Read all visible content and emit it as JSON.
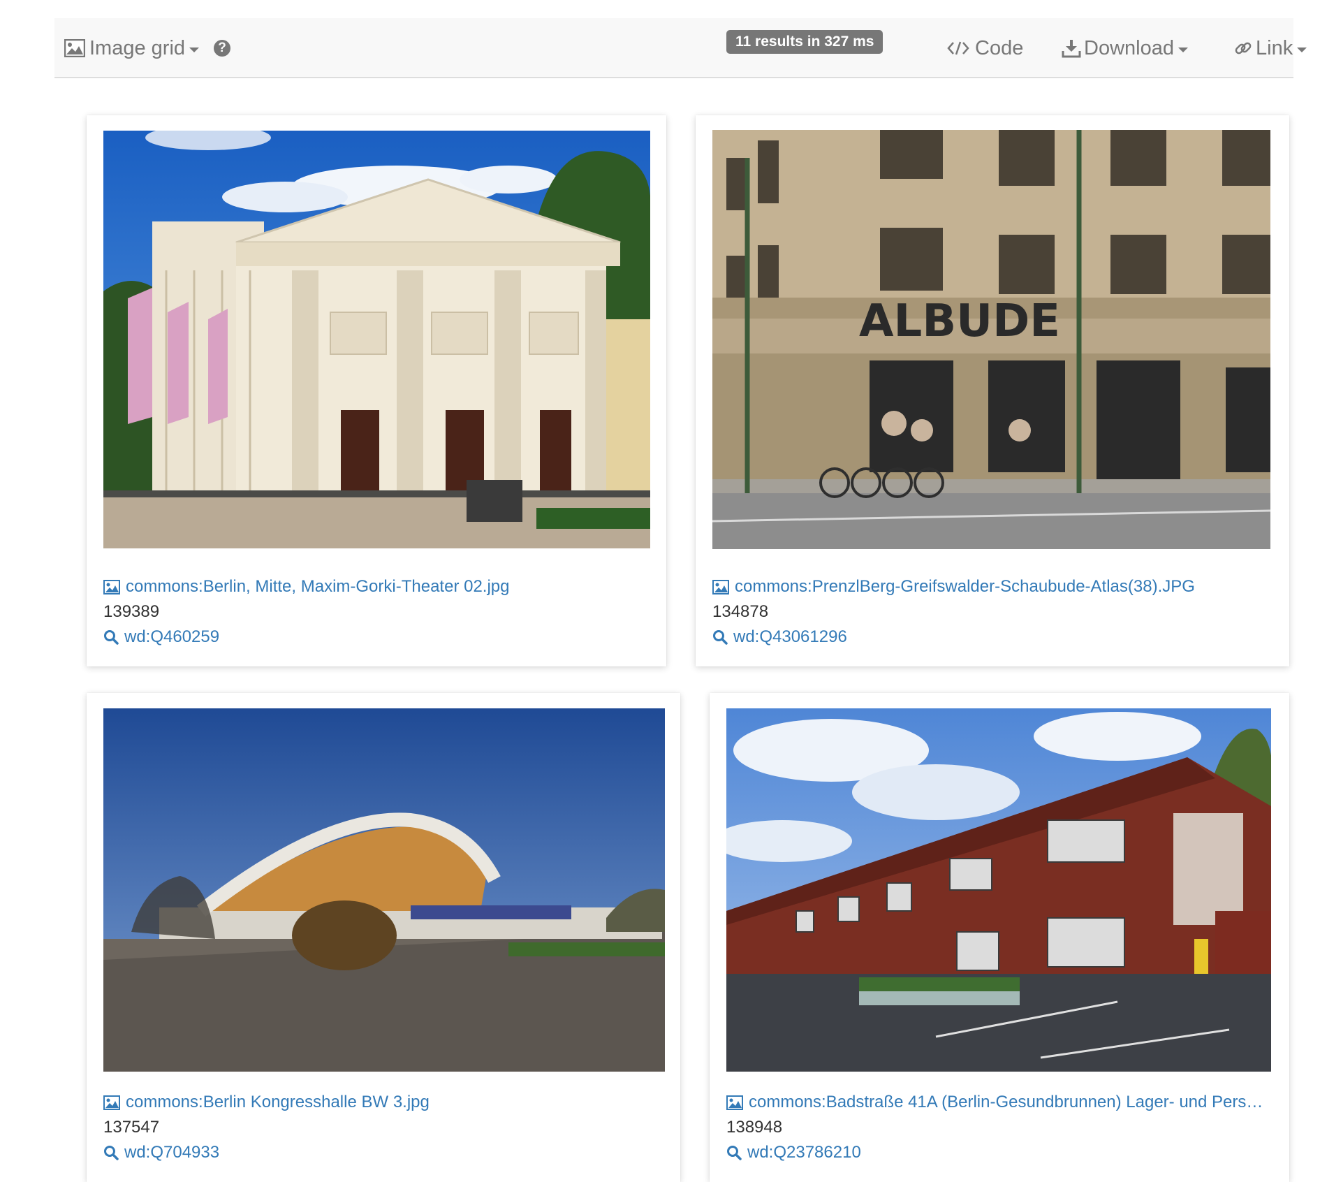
{
  "toolbar": {
    "view_label": "Image grid",
    "results_badge": "11 results in 327 ms",
    "code_label": "Code",
    "download_label": "Download",
    "link_label": "Link"
  },
  "results": [
    {
      "file": "commons:Berlin, Mitte, Maxim-Gorki-Theater 02.jpg",
      "number": "139389",
      "item": "wd:Q460259"
    },
    {
      "file": "commons:PrenzlBerg-Greifswalder-Schaubude-Atlas(38).JPG",
      "number": "134878",
      "item": "wd:Q43061296"
    },
    {
      "file": "commons:Berlin Kongresshalle BW 3.jpg",
      "number": "137547",
      "item": "wd:Q704933"
    },
    {
      "file": "commons:Badstraße 41A (Berlin-Gesundbrunnen) Lager- und Pers…",
      "number": "138948",
      "item": "wd:Q23786210"
    }
  ],
  "colors": {
    "link": "#337ab7",
    "toolbar_bg": "#f8f8f8",
    "muted": "#777777",
    "text": "#333333"
  },
  "icons": [
    "image-icon",
    "question-circle-icon",
    "code-icon",
    "download-icon",
    "link-icon",
    "search-icon",
    "chevron-down-icon"
  ]
}
